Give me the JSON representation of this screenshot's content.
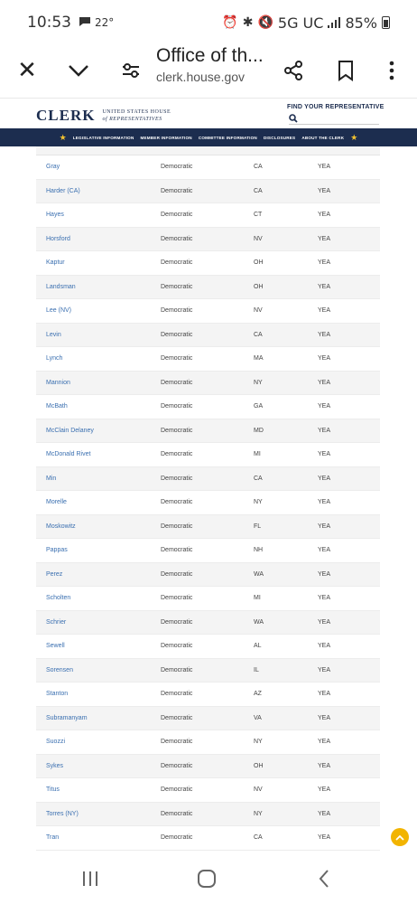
{
  "status_bar": {
    "time": "10:53",
    "temp": "22°",
    "network": "5G UC",
    "battery": "85%"
  },
  "browser": {
    "page_title": "Office of th...",
    "domain": "clerk.house.gov"
  },
  "site": {
    "logo_word": "CLERK",
    "logo_line1": "UNITED STATES HOUSE",
    "logo_line2": "of REPRESENTATIVES",
    "find_rep": "FIND YOUR REPRESENTATIVE",
    "nav": [
      "LEGISLATIVE INFORMATION",
      "MEMBER INFORMATION",
      "COMMITTEE INFORMATION",
      "DISCLOSURES",
      "ABOUT THE CLERK"
    ]
  },
  "votes": [
    {
      "name": "Gray",
      "party": "Democratic",
      "state": "CA",
      "vote": "YEA"
    },
    {
      "name": "Harder (CA)",
      "party": "Democratic",
      "state": "CA",
      "vote": "YEA"
    },
    {
      "name": "Hayes",
      "party": "Democratic",
      "state": "CT",
      "vote": "YEA"
    },
    {
      "name": "Horsford",
      "party": "Democratic",
      "state": "NV",
      "vote": "YEA"
    },
    {
      "name": "Kaptur",
      "party": "Democratic",
      "state": "OH",
      "vote": "YEA"
    },
    {
      "name": "Landsman",
      "party": "Democratic",
      "state": "OH",
      "vote": "YEA"
    },
    {
      "name": "Lee (NV)",
      "party": "Democratic",
      "state": "NV",
      "vote": "YEA"
    },
    {
      "name": "Levin",
      "party": "Democratic",
      "state": "CA",
      "vote": "YEA"
    },
    {
      "name": "Lynch",
      "party": "Democratic",
      "state": "MA",
      "vote": "YEA"
    },
    {
      "name": "Mannion",
      "party": "Democratic",
      "state": "NY",
      "vote": "YEA"
    },
    {
      "name": "McBath",
      "party": "Democratic",
      "state": "GA",
      "vote": "YEA"
    },
    {
      "name": "McClain Delaney",
      "party": "Democratic",
      "state": "MD",
      "vote": "YEA"
    },
    {
      "name": "McDonald Rivet",
      "party": "Democratic",
      "state": "MI",
      "vote": "YEA"
    },
    {
      "name": "Min",
      "party": "Democratic",
      "state": "CA",
      "vote": "YEA"
    },
    {
      "name": "Morelle",
      "party": "Democratic",
      "state": "NY",
      "vote": "YEA"
    },
    {
      "name": "Moskowitz",
      "party": "Democratic",
      "state": "FL",
      "vote": "YEA"
    },
    {
      "name": "Pappas",
      "party": "Democratic",
      "state": "NH",
      "vote": "YEA"
    },
    {
      "name": "Perez",
      "party": "Democratic",
      "state": "WA",
      "vote": "YEA"
    },
    {
      "name": "Scholten",
      "party": "Democratic",
      "state": "MI",
      "vote": "YEA"
    },
    {
      "name": "Schrier",
      "party": "Democratic",
      "state": "WA",
      "vote": "YEA"
    },
    {
      "name": "Sewell",
      "party": "Democratic",
      "state": "AL",
      "vote": "YEA"
    },
    {
      "name": "Sorensen",
      "party": "Democratic",
      "state": "IL",
      "vote": "YEA"
    },
    {
      "name": "Stanton",
      "party": "Democratic",
      "state": "AZ",
      "vote": "YEA"
    },
    {
      "name": "Subramanyam",
      "party": "Democratic",
      "state": "VA",
      "vote": "YEA"
    },
    {
      "name": "Suozzi",
      "party": "Democratic",
      "state": "NY",
      "vote": "YEA"
    },
    {
      "name": "Sykes",
      "party": "Democratic",
      "state": "OH",
      "vote": "YEA"
    },
    {
      "name": "Titus",
      "party": "Democratic",
      "state": "NV",
      "vote": "YEA"
    },
    {
      "name": "Torres (NY)",
      "party": "Democratic",
      "state": "NY",
      "vote": "YEA"
    },
    {
      "name": "Tran",
      "party": "Democratic",
      "state": "CA",
      "vote": "YEA"
    }
  ],
  "colors": {
    "navy": "#1c2d4f",
    "link": "#3a6fb0",
    "accent": "#f2b400"
  }
}
